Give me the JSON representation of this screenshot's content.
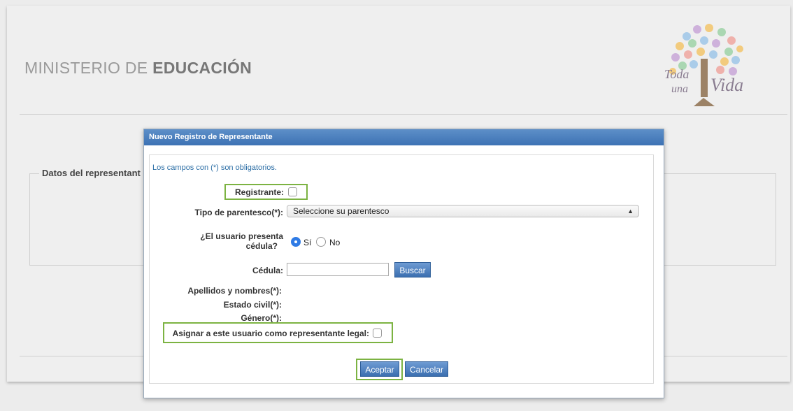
{
  "header": {
    "logo_light": "MINISTERIO DE ",
    "logo_bold": "EDUCACIÓN",
    "tree_text_1": "Toda",
    "tree_text_2": "una",
    "tree_text_3": "Vida"
  },
  "background_form": {
    "legend": "Datos del representant"
  },
  "dialog": {
    "title": "Nuevo Registro de Representante",
    "note": "Los campos con (*) son obligatorios.",
    "registrante_label": "Registrante:",
    "parentesco_label": "Tipo de parentesco(*):",
    "parentesco_value": "Seleccione su parentesco",
    "cedula_question_line1": "¿El usuario presenta",
    "cedula_question_line2": "cédula?",
    "radio_si": "Sí",
    "radio_no": "No",
    "cedula_label": "Cédula:",
    "cedula_value": "",
    "buscar_button": "Buscar",
    "apellidos_label": "Apellidos y nombres(*):",
    "estado_civil_label": "Estado civil(*):",
    "genero_label": "Género(*):",
    "representante_legal_label": "Asignar a este usuario como representante legal:",
    "aceptar_button": "Aceptar",
    "cancelar_button": "Cancelar"
  },
  "colors": {
    "highlight": "#7cb342",
    "title_bar": "#3d72b4",
    "radio_selected": "#2f7be5"
  }
}
